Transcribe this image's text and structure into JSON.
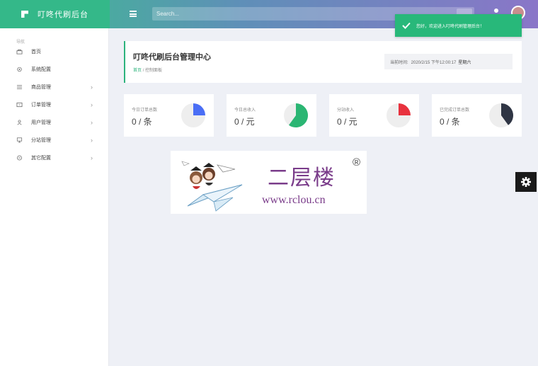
{
  "app": {
    "name": "叮咚代刷后台"
  },
  "search": {
    "placeholder": "Search..."
  },
  "toast": {
    "message": "您好，欢迎进入叮咚代刷管理后台！"
  },
  "sidebar": {
    "header": "导航",
    "items": [
      {
        "label": "首页",
        "icon": "home-icon",
        "has_submenu": false
      },
      {
        "label": "系统配置",
        "icon": "settings-icon",
        "has_submenu": false
      },
      {
        "label": "商品管理",
        "icon": "list-icon",
        "has_submenu": true
      },
      {
        "label": "订单管理",
        "icon": "monitor-icon",
        "has_submenu": true
      },
      {
        "label": "用户管理",
        "icon": "user-icon",
        "has_submenu": true
      },
      {
        "label": "分站管理",
        "icon": "display-icon",
        "has_submenu": true
      },
      {
        "label": "其它配置",
        "icon": "chat-icon",
        "has_submenu": true
      }
    ]
  },
  "header": {
    "title": "叮咚代刷后台管理中心",
    "breadcrumb_home": "首页",
    "breadcrumb_separator": "/",
    "breadcrumb_current": "控制面板",
    "time_label": "当前时间:",
    "time_value": "2020/2/15 下午12:00:17",
    "weekday": "星期六"
  },
  "stats": [
    {
      "label": "今日订单总数",
      "value": "0 / 条",
      "pie_color": "#4a6ef5",
      "pie_fraction": 0.25
    },
    {
      "label": "今日总收入",
      "value": "0 / 元",
      "pie_color": "#2bb673",
      "pie_fraction": 0.6
    },
    {
      "label": "分站收入",
      "value": "0 / 元",
      "pie_color": "#e8323e",
      "pie_fraction": 0.25
    },
    {
      "label": "已完成订单总数",
      "value": "0 / 条",
      "pie_color": "#2f3544",
      "pie_fraction": 0.4
    }
  ],
  "promo": {
    "title": "二层楼",
    "registered": "®",
    "url": "www.rclou.cn"
  }
}
